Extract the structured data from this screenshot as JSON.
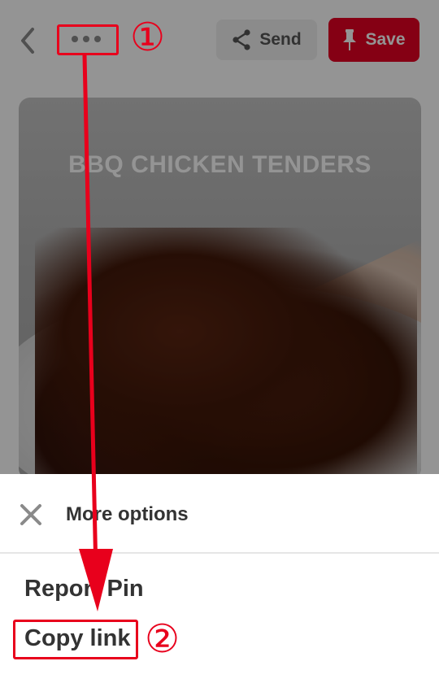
{
  "header": {
    "back_icon": "chevron-left-icon",
    "more_icon": "ellipsis-icon",
    "send": {
      "label": "Send",
      "icon": "share-icon"
    },
    "save": {
      "label": "Save",
      "icon": "pushpin-icon",
      "color": "#e60023"
    }
  },
  "pin": {
    "title": "BBQ CHICKEN TENDERS"
  },
  "sheet": {
    "close_icon": "close-icon",
    "title": "More options",
    "options": [
      {
        "label": "Report Pin"
      },
      {
        "label": "Copy link"
      }
    ]
  },
  "annotations": {
    "step1": "①",
    "step2": "②",
    "color": "#e8001c"
  }
}
